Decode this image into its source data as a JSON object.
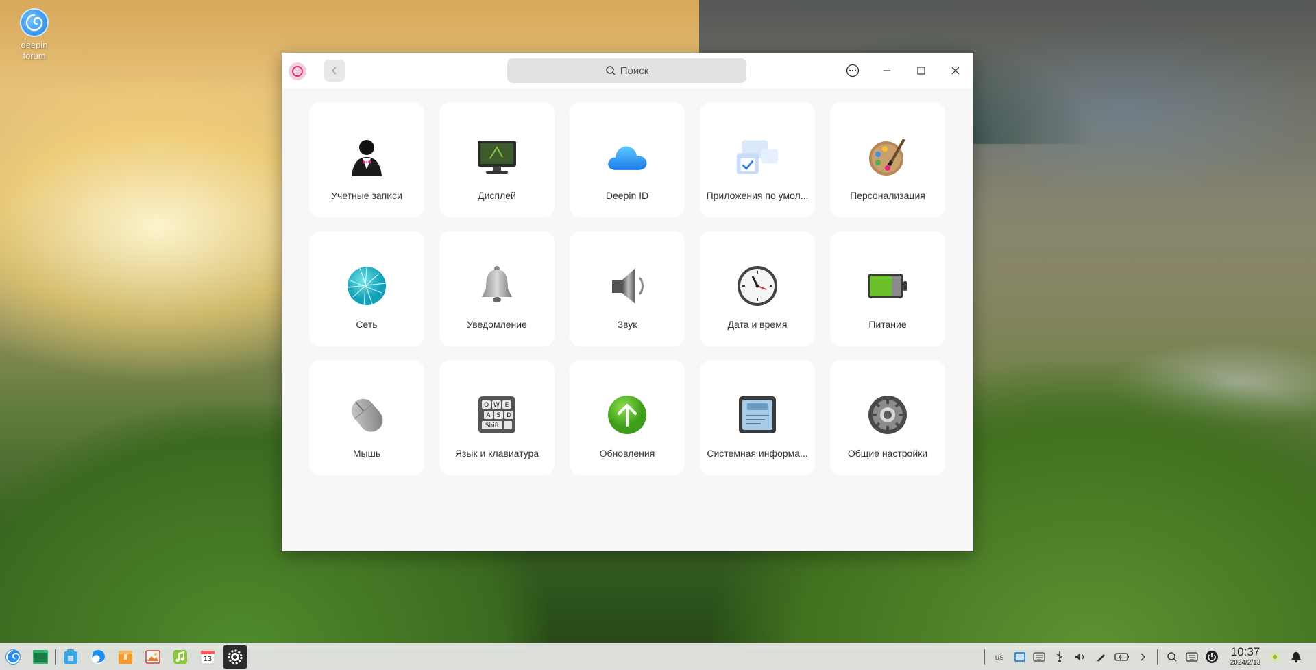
{
  "desktop": {
    "icon_label": "deepin forum"
  },
  "window": {
    "search_placeholder": "Поиск",
    "tiles": [
      {
        "label": "Учетные записи",
        "icon": "accounts-icon"
      },
      {
        "label": "Дисплей",
        "icon": "display-icon"
      },
      {
        "label": "Deepin ID",
        "icon": "cloud-icon"
      },
      {
        "label": "Приложения по умол...",
        "icon": "default-apps-icon"
      },
      {
        "label": "Персонализация",
        "icon": "palette-icon"
      },
      {
        "label": "Сеть",
        "icon": "network-icon"
      },
      {
        "label": "Уведомление",
        "icon": "bell-icon"
      },
      {
        "label": "Звук",
        "icon": "speaker-icon"
      },
      {
        "label": "Дата и время",
        "icon": "clock-icon"
      },
      {
        "label": "Питание",
        "icon": "battery-icon"
      },
      {
        "label": "Мышь",
        "icon": "mouse-icon"
      },
      {
        "label": "Язык и клавиатура",
        "icon": "keyboard-icon"
      },
      {
        "label": "Обновления",
        "icon": "update-arrow-icon"
      },
      {
        "label": "Системная информа...",
        "icon": "system-info-icon"
      },
      {
        "label": "Общие настройки",
        "icon": "gear-icon"
      }
    ]
  },
  "taskbar": {
    "keyboard_layout": "us",
    "time": "10:37",
    "date": "2024/2/13",
    "calendar_day": "13"
  }
}
